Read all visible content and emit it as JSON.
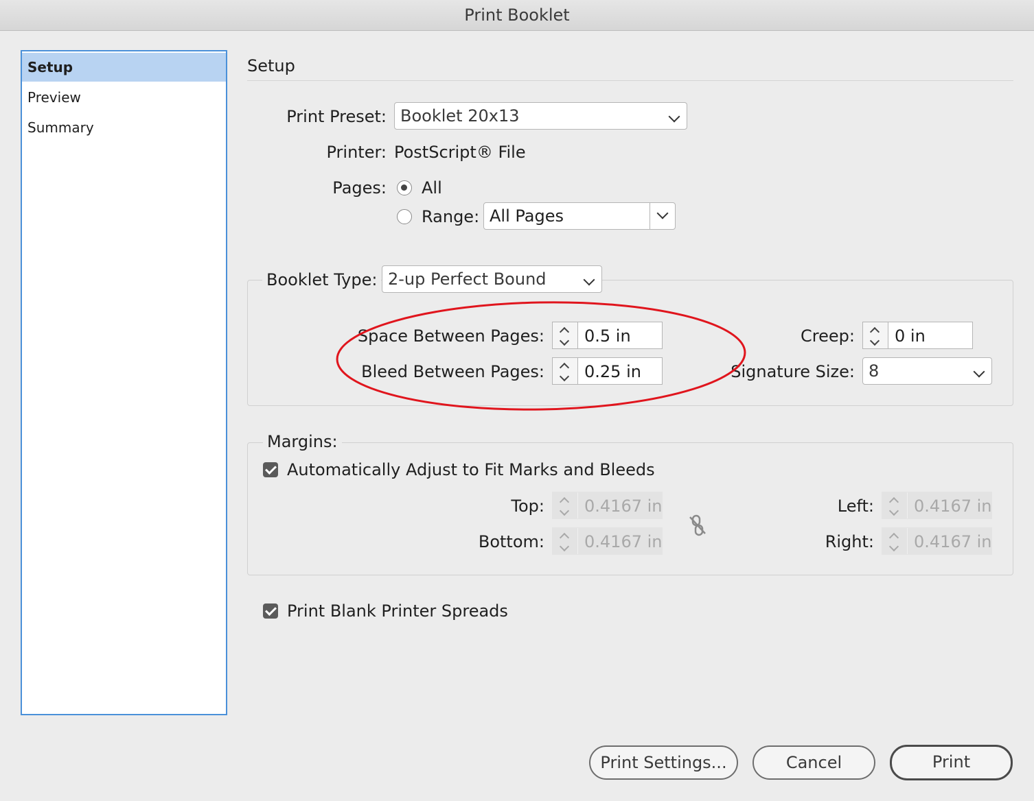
{
  "window": {
    "title": "Print Booklet"
  },
  "sidebar": {
    "items": [
      {
        "label": "Setup",
        "selected": true
      },
      {
        "label": "Preview",
        "selected": false
      },
      {
        "label": "Summary",
        "selected": false
      }
    ]
  },
  "setup": {
    "heading": "Setup",
    "print_preset": {
      "label": "Print Preset:",
      "value": "Booklet 20x13"
    },
    "printer": {
      "label": "Printer:",
      "value": "PostScript® File"
    },
    "pages": {
      "label": "Pages:",
      "all_label": "All",
      "range_label": "Range:",
      "range_value": "All Pages",
      "selected": "All"
    }
  },
  "booklet": {
    "type_label": "Booklet Type:",
    "type_value": "2-up Perfect Bound",
    "space_between": {
      "label": "Space Between Pages:",
      "value": "0.5 in"
    },
    "bleed_between": {
      "label": "Bleed Between Pages:",
      "value": "0.25 in"
    },
    "creep": {
      "label": "Creep:",
      "value": "0 in"
    },
    "signature_size": {
      "label": "Signature Size:",
      "value": "8"
    },
    "highlight_color": "#e0151d"
  },
  "margins": {
    "legend": "Margins:",
    "auto_adjust": {
      "label": "Automatically Adjust to Fit Marks and Bleeds",
      "checked": true
    },
    "top": {
      "label": "Top:",
      "value": "0.4167 in"
    },
    "bottom": {
      "label": "Bottom:",
      "value": "0.4167 in"
    },
    "left": {
      "label": "Left:",
      "value": "0.4167 in"
    },
    "right": {
      "label": "Right:",
      "value": "0.4167 in"
    }
  },
  "print_blank": {
    "label": "Print Blank Printer Spreads",
    "checked": true
  },
  "buttons": {
    "print_settings": "Print Settings...",
    "cancel": "Cancel",
    "print": "Print"
  }
}
